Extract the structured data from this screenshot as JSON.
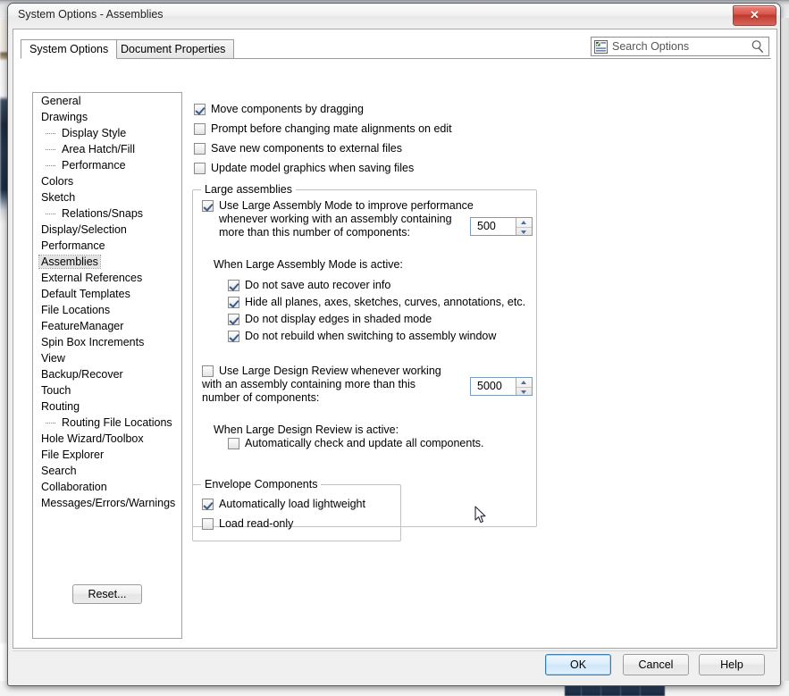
{
  "window": {
    "title": "System Options - Assemblies",
    "close_label": "✕",
    "close_icon": "close-icon"
  },
  "tabs": [
    {
      "label": "System Options",
      "active": true
    },
    {
      "label": "Document Properties",
      "active": false
    }
  ],
  "search": {
    "placeholder": "Search Options",
    "value": "",
    "left_icon": "options-list-icon",
    "right_icon": "magnifier-icon"
  },
  "tree": {
    "selected": "Assemblies",
    "items": [
      {
        "label": "General",
        "level": 0
      },
      {
        "label": "Drawings",
        "level": 0
      },
      {
        "label": "Display Style",
        "level": 1
      },
      {
        "label": "Area Hatch/Fill",
        "level": 1
      },
      {
        "label": "Performance",
        "level": 1
      },
      {
        "label": "Colors",
        "level": 0
      },
      {
        "label": "Sketch",
        "level": 0
      },
      {
        "label": "Relations/Snaps",
        "level": 1
      },
      {
        "label": "Display/Selection",
        "level": 0
      },
      {
        "label": "Performance",
        "level": 0
      },
      {
        "label": "Assemblies",
        "level": 0
      },
      {
        "label": "External References",
        "level": 0
      },
      {
        "label": "Default Templates",
        "level": 0
      },
      {
        "label": "File Locations",
        "level": 0
      },
      {
        "label": "FeatureManager",
        "level": 0
      },
      {
        "label": "Spin Box Increments",
        "level": 0
      },
      {
        "label": "View",
        "level": 0
      },
      {
        "label": "Backup/Recover",
        "level": 0
      },
      {
        "label": "Touch",
        "level": 0
      },
      {
        "label": "Routing",
        "level": 0
      },
      {
        "label": "Routing File Locations",
        "level": 1
      },
      {
        "label": "Hole Wizard/Toolbox",
        "level": 0
      },
      {
        "label": "File Explorer",
        "level": 0
      },
      {
        "label": "Search",
        "level": 0
      },
      {
        "label": "Collaboration",
        "level": 0
      },
      {
        "label": "Messages/Errors/Warnings",
        "level": 0
      }
    ]
  },
  "options": {
    "top_checkboxes": [
      {
        "label": "Move components by dragging",
        "checked": true
      },
      {
        "label": "Prompt before changing mate alignments on edit",
        "checked": false
      },
      {
        "label": "Save new components to external files",
        "checked": false
      },
      {
        "label": "Update model graphics when saving files",
        "checked": false
      }
    ],
    "large_assemblies": {
      "title": "Large assemblies",
      "lam_checkbox": {
        "label_line1": "Use Large Assembly Mode to improve performance",
        "label_line2": "whenever working with an assembly containing",
        "label_line3": "more than this number of components:",
        "checked": true
      },
      "lam_spin": {
        "value": "500"
      },
      "lam_active_heading": "When Large Assembly Mode is active:",
      "lam_suboptions": [
        {
          "label": "Do not save auto recover info",
          "checked": true
        },
        {
          "label": "Hide all planes, axes, sketches, curves, annotations, etc.",
          "checked": true
        },
        {
          "label": "Do not display edges in shaded mode",
          "checked": true
        },
        {
          "label": "Do not rebuild when switching to assembly window",
          "checked": true
        }
      ],
      "ldr_checkbox": {
        "label_line1": "Use Large Design Review whenever working",
        "label_line2": "with an assembly containing more than this",
        "label_line3": "number of components:",
        "checked": false
      },
      "ldr_spin": {
        "value": "5000"
      },
      "ldr_active_heading": "When Large Design Review is active:",
      "ldr_suboptions": [
        {
          "label": "Automatically check and update all components.",
          "checked": false
        }
      ]
    },
    "envelope_components": {
      "title": "Envelope Components",
      "checkboxes": [
        {
          "label": "Automatically load lightweight",
          "checked": true
        },
        {
          "label": "Load read-only",
          "checked": false
        }
      ]
    }
  },
  "buttons": {
    "reset": "Reset...",
    "ok": "OK",
    "cancel": "Cancel",
    "help": "Help"
  },
  "colors": {
    "accent": "#3c7fb1",
    "check": "#3a5a8c",
    "close": "#c0392c",
    "selection": "#e3e3e3"
  }
}
